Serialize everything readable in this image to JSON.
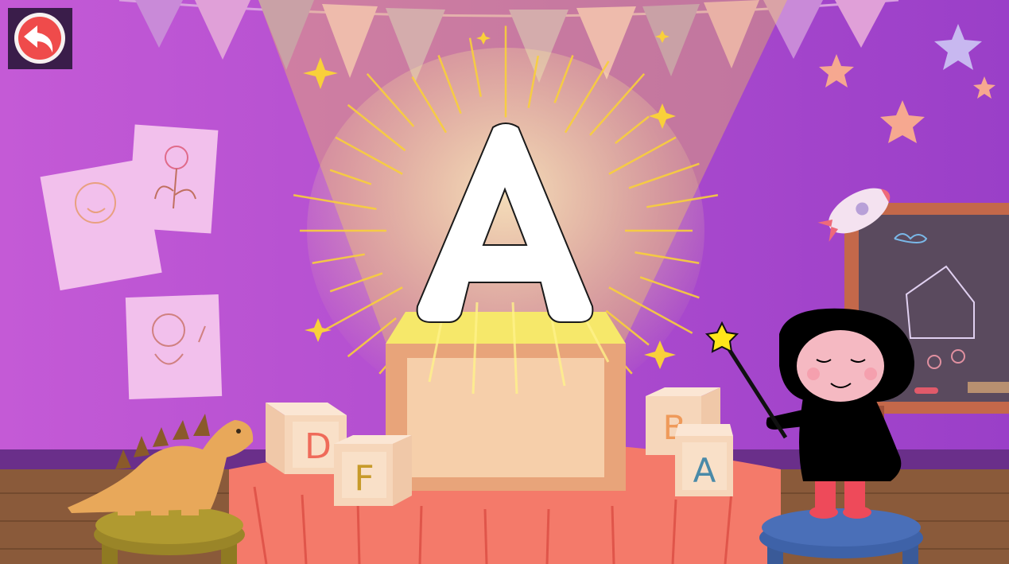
{
  "scene": {
    "colors": {
      "wall": "#b24fd0",
      "floor": "#8a5a3a",
      "table": "#f47a6a",
      "light": "#ffe98a",
      "back_button": "#ef4b4b",
      "character": "#000000",
      "character_face": "#f5b9c2",
      "stool_left": "#a8922c",
      "stool_right": "#4a6fb8",
      "chalkboard": "#5a4a5e",
      "wand_star": "#ffe61a"
    },
    "big_letter": "A",
    "blocks": [
      {
        "letter": "D",
        "color": "#ef6b5a"
      },
      {
        "letter": "F",
        "color": "#c79a2a"
      },
      {
        "letter": "B",
        "color": "#ef9a5a"
      },
      {
        "letter": "A",
        "color": "#4a8aa8"
      }
    ],
    "icons": [
      "back-arrow-icon",
      "magic-wand-icon",
      "dinosaur-toy",
      "rocket-icon",
      "chalkboard"
    ]
  }
}
